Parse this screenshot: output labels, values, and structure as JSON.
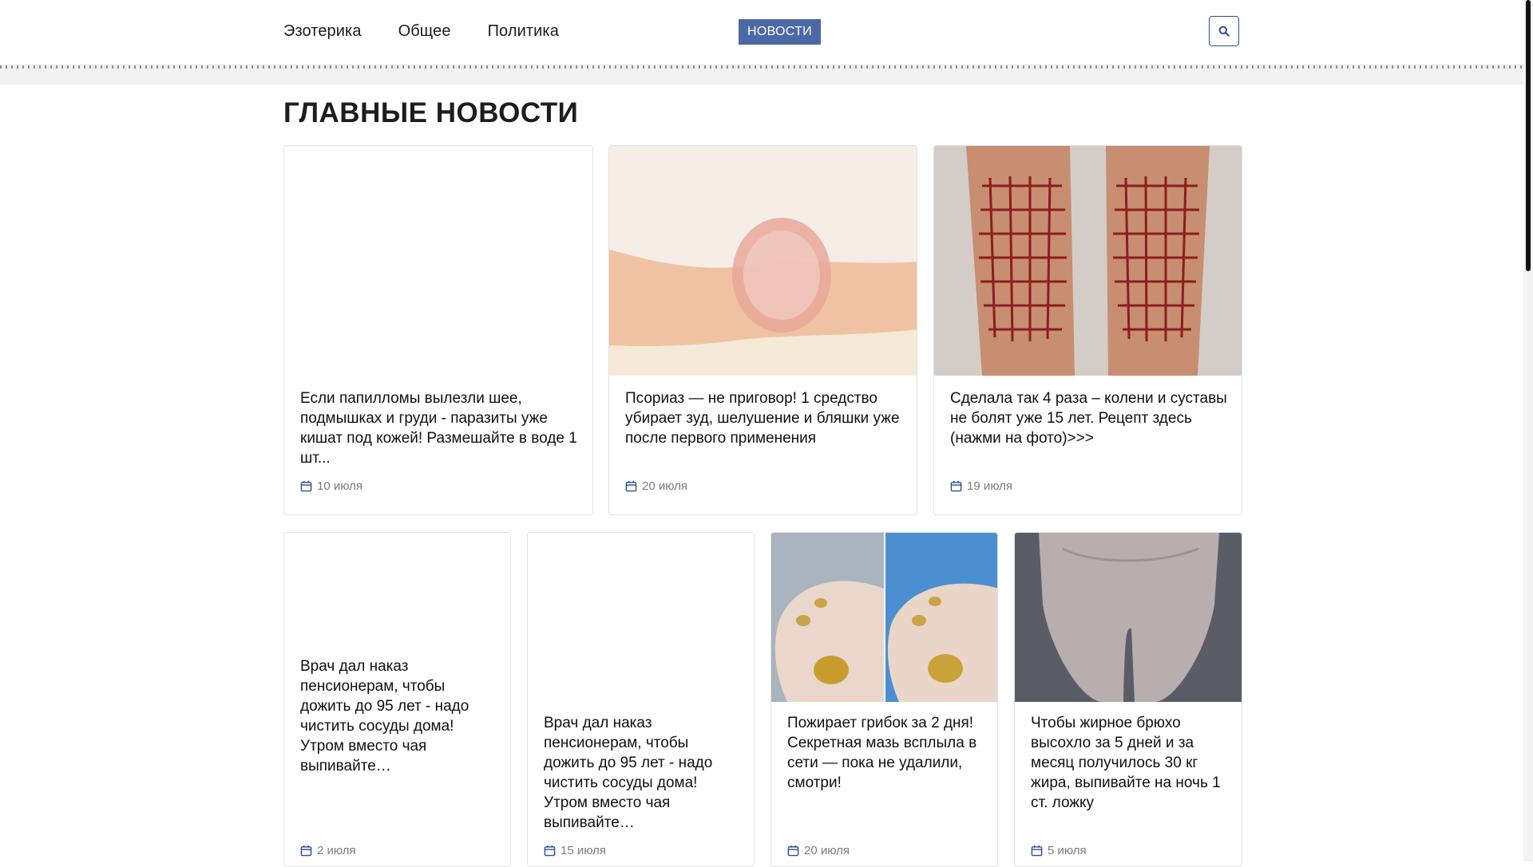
{
  "header": {
    "nav": [
      "Эзотерика",
      "Общее",
      "Политика"
    ],
    "badge": "НОВОСТИ"
  },
  "page_title": "ГЛАВНЫЕ НОВОСТИ",
  "row1": [
    {
      "headline": "Если папилломы вылезли шее, подмышках и груди - паразиты уже кишат под кожей! Размешайте в воде 1 шт...",
      "date": "10 июля"
    },
    {
      "headline": "Псориаз — не приговор! 1 средство убирает зуд, шелушение и бляшки уже после первого применения",
      "date": "20 июля"
    },
    {
      "headline": "Сделала так 4 раза – колени и суставы не болят уже 15 лет. Рецепт здесь (нажми на фото)>>>",
      "date": "19 июля"
    }
  ],
  "row2": [
    {
      "headline": "Врач дал наказ пенсионерам, чтобы дожить до 95 лет - надо чистить сосуды дома! Утром вместо чая выпивайте…",
      "date": "2 июля"
    },
    {
      "headline": "Врач дал наказ пенсионерам, чтобы дожить до 95 лет - надо чистить сосуды дома! Утром вместо чая выпивайте…",
      "date": "15 июля"
    },
    {
      "headline": "Пожирает грибок за 2 дня! Секретная мазь всплыла в сети — пока не удалили, смотри!",
      "date": "20 июля"
    },
    {
      "headline": "Чтобы жирное брюхо высохло за 5 дней и за месяц получилось 30 кг жира, выпивайте на ночь 1 ст. ложку",
      "date": "5 июля"
    }
  ],
  "colors": {
    "accent": "#4b69a7",
    "icon_blue": "#2a4f8f"
  },
  "icons": {
    "search": "search-icon",
    "calendar": "calendar-icon"
  }
}
